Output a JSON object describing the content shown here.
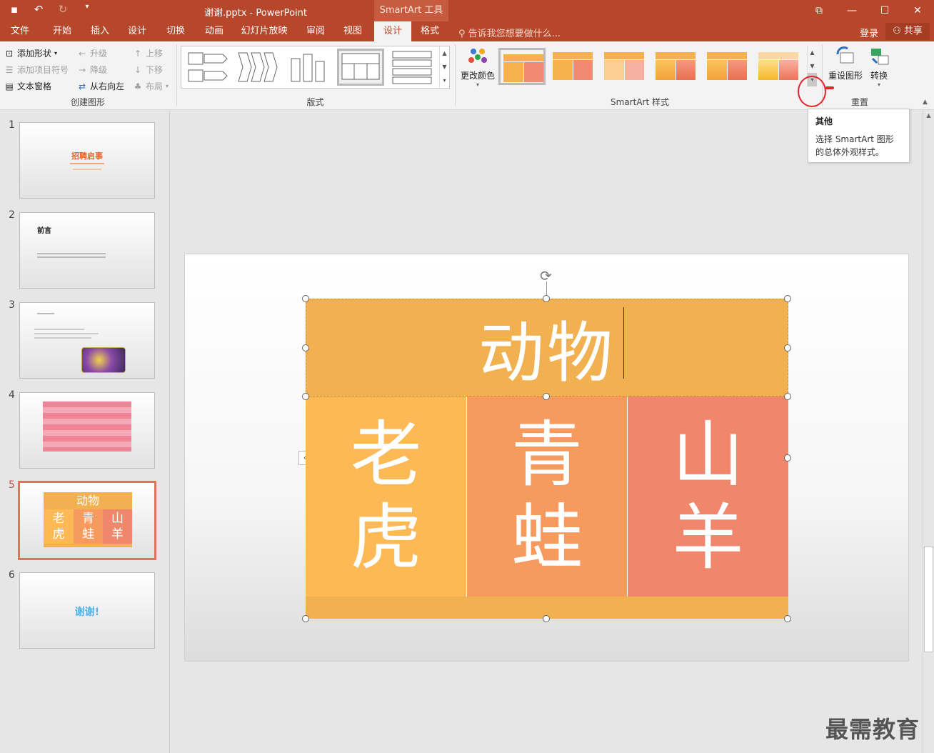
{
  "titlebar": {
    "doc_title": "谢谢.pptx - PowerPoint",
    "context_tool": "SmartArt 工具",
    "qat_icons": [
      "save-icon",
      "undo-icon",
      "redo-icon",
      "customize-icon"
    ]
  },
  "tabs": {
    "file": "文件",
    "home": "开始",
    "insert": "插入",
    "design": "设计",
    "transitions": "切换",
    "animations": "动画",
    "slideshow": "幻灯片放映",
    "review": "审阅",
    "view": "视图",
    "sa_design": "设计",
    "sa_format": "格式",
    "tellme": "告诉我您想要做什么...",
    "login": "登录",
    "share": "共享"
  },
  "ribbon": {
    "create": {
      "add_shape": "添加形状",
      "add_bullet": "添加项目符号",
      "text_pane": "文本窗格",
      "promote": "升级",
      "demote": "降级",
      "rtl": "从右向左",
      "move_up": "上移",
      "move_down": "下移",
      "layout": "布局",
      "label": "创建图形"
    },
    "layouts_label": "版式",
    "change_colors": "更改颜色",
    "styles_label": "SmartArt 样式",
    "reset": {
      "reset_graphic": "重设图形",
      "convert": "转换",
      "label": "重置"
    },
    "style_colors": {
      "orange": "#f5b04f",
      "salmon": "#f08a72"
    }
  },
  "tooltip": {
    "title": "其他",
    "body": "选择 SmartArt 图形的总体外观样式。"
  },
  "thumbnails": {
    "numbers": [
      "1",
      "2",
      "3",
      "4",
      "5",
      "6"
    ],
    "s1_title": "招聘启事",
    "s2_title": "前言",
    "s5_title": "动物",
    "s5_c1": "老虎",
    "s5_c2": "青蛙",
    "s5_c3": "山羊",
    "s6_title": "谢谢!"
  },
  "smartart": {
    "top": "动物",
    "cells": [
      {
        "line1": "老",
        "line2": "虎"
      },
      {
        "line1": "青",
        "line2": "蛙"
      },
      {
        "line1": "山",
        "line2": "羊"
      }
    ],
    "colors": {
      "top": "#f2b151",
      "cell1": "#fdb955",
      "cell2": "#f79a5e",
      "cell3": "#f0866c"
    }
  },
  "watermark": "最需教育"
}
